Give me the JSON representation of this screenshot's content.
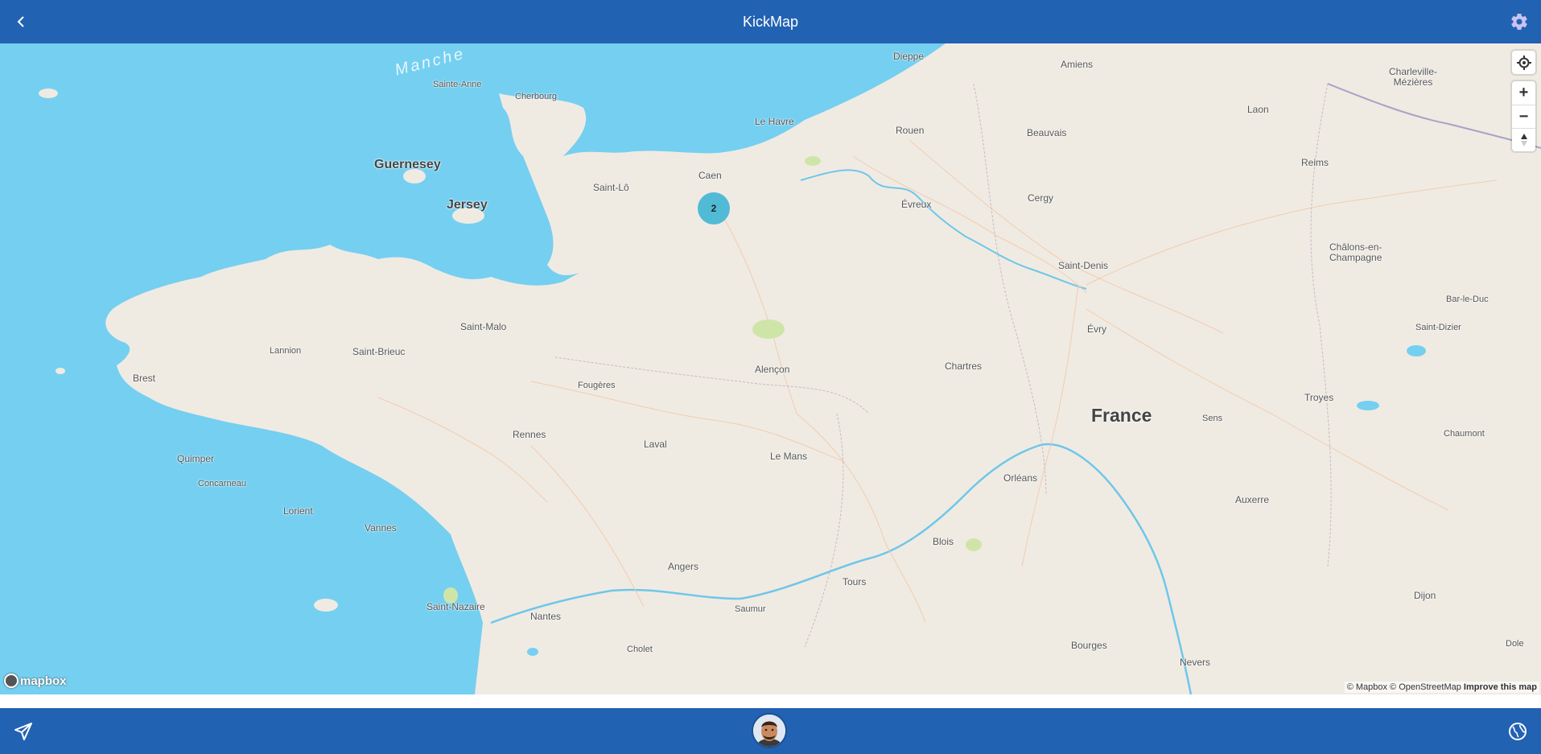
{
  "header": {
    "title": "KickMap"
  },
  "icons": {
    "back": "chevron-left-icon",
    "settings": "gear-icon",
    "send": "send-icon",
    "globe": "globe-icon",
    "locate": "crosshair-icon",
    "compass": "compass-icon"
  },
  "colors": {
    "brand": "#2262b3",
    "water": "#75cff0",
    "land": "#efebe3",
    "cluster": "#51bbd6"
  },
  "map": {
    "cluster_count": "2",
    "sea_label": "Manche",
    "country_label": "France",
    "islands": [
      "Guernesey",
      "Jersey"
    ],
    "places": [
      "Dieppe",
      "Amiens",
      "Charleville-Mézières",
      "Sainte-Anne",
      "Cherbourg",
      "Le Havre",
      "Rouen",
      "Laon",
      "Beauvais",
      "Reims",
      "Caen",
      "Saint-Lô",
      "Cergy",
      "Évreux",
      "Saint-Denis",
      "Châlons-en-Champagne",
      "Lannion",
      "Saint-Malo",
      "Bar-le-Duc",
      "Évry",
      "Saint-Dizier",
      "Saint-Brieuc",
      "Brest",
      "Alençon",
      "Chartres",
      "Fougères",
      "Troyes",
      "Rennes",
      "Sens",
      "Chaumont",
      "Laval",
      "Quimper",
      "Le Mans",
      "Concarneau",
      "Orléans",
      "Lorient",
      "Auxerre",
      "Vannes",
      "Blois",
      "Angers",
      "Tours",
      "Dijon",
      "Saint-Nazaire",
      "Nantes",
      "Saumur",
      "Bourges",
      "Cholet",
      "Nevers",
      "Dole"
    ],
    "zoom_in": "+",
    "zoom_out": "−",
    "attribution": "© Mapbox © OpenStreetMap",
    "improve": "Improve this map",
    "logo": "mapbox"
  }
}
